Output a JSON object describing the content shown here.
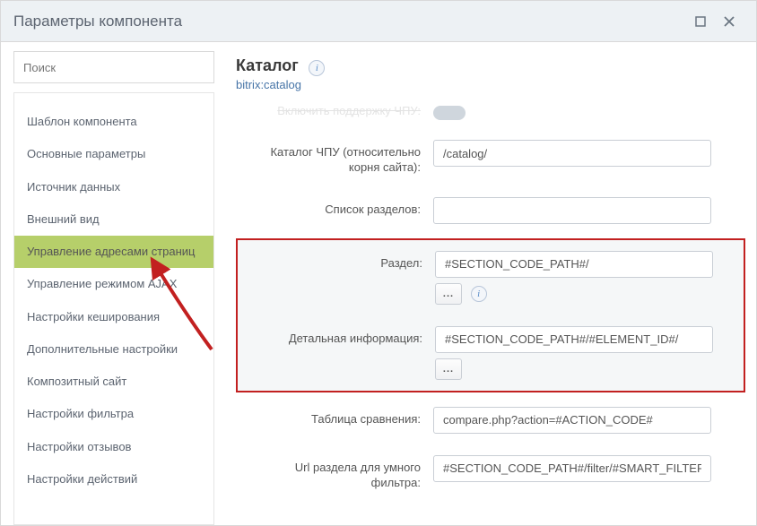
{
  "window": {
    "title": "Параметры компонента"
  },
  "search": {
    "placeholder": "Поиск"
  },
  "sidebar": {
    "items": [
      {
        "label": "Шаблон компонента"
      },
      {
        "label": "Основные параметры"
      },
      {
        "label": "Источник данных"
      },
      {
        "label": "Внешний вид"
      },
      {
        "label": "Управление адресами страниц",
        "active": true
      },
      {
        "label": "Управление режимом AJAX"
      },
      {
        "label": "Настройки кеширования"
      },
      {
        "label": "Дополнительные настройки"
      },
      {
        "label": "Композитный сайт"
      },
      {
        "label": "Настройки фильтра"
      },
      {
        "label": "Настройки отзывов"
      },
      {
        "label": "Настройки действий"
      }
    ]
  },
  "header": {
    "title": "Каталог",
    "component": "bitrix:catalog"
  },
  "params": {
    "cut_label": "Включить поддержку ЧПУ:",
    "sef_folder": {
      "label": "Каталог ЧПУ (относительно корня сайта):",
      "value": "/catalog/"
    },
    "sections": {
      "label": "Список разделов:",
      "value": ""
    },
    "section": {
      "label": "Раздел:",
      "value": "#SECTION_CODE_PATH#/"
    },
    "detail": {
      "label": "Детальная информация:",
      "value": "#SECTION_CODE_PATH#/#ELEMENT_ID#/"
    },
    "compare": {
      "label": "Таблица сравнения:",
      "value": "compare.php?action=#ACTION_CODE#"
    },
    "smart_filter": {
      "label": "Url раздела для умного фильтра:",
      "value": "#SECTION_CODE_PATH#/filter/#SMART_FILTER_PATH#/"
    }
  }
}
